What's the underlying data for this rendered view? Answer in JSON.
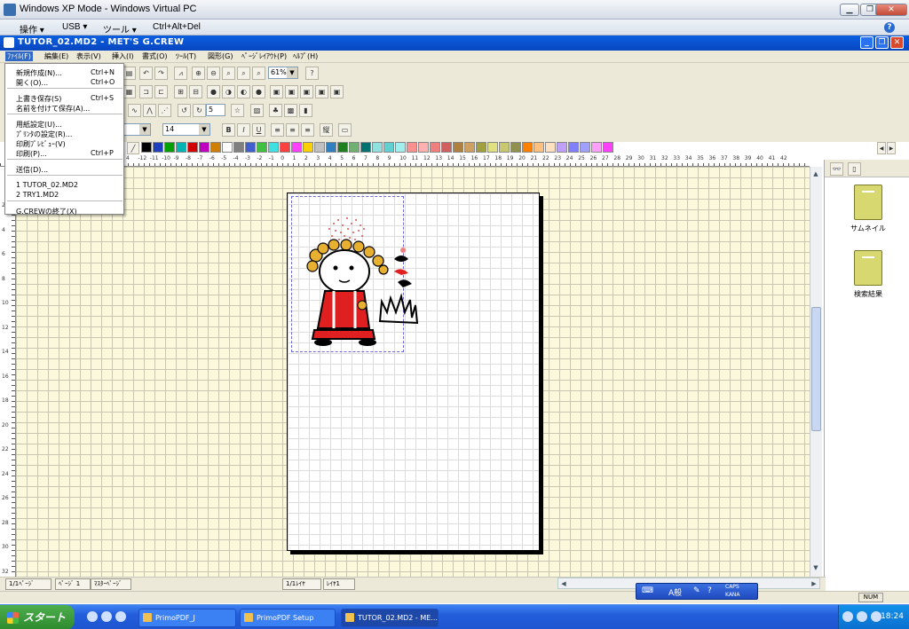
{
  "vpc": {
    "title": "Windows XP Mode - Windows Virtual PC",
    "menu": [
      "操作 ▾",
      "USB ▾",
      "ツール ▾",
      "Ctrl+Alt+Del"
    ],
    "help_icon": "help-icon"
  },
  "app": {
    "title": "TUTOR_02.MD2 - MET'S G.CREW",
    "menu": [
      "ﾌｧｲﾙ(F)",
      "編集(E)",
      "表示(V)",
      "挿入(I)",
      "書式(O)",
      "ﾂｰﾙ(T)",
      "図形(G)",
      "ﾍﾟｰｼﾞﾚｲｱｳﾄ(P)",
      "ﾍﾙﾌﾟ(H)"
    ],
    "zoom": "61%",
    "font_size": "14",
    "number_field": "5"
  },
  "file_menu": [
    {
      "label": "新規作成(N)...",
      "shortcut": "Ctrl+N"
    },
    {
      "label": "開く(O)...",
      "shortcut": "Ctrl+O"
    },
    {
      "label": "上書き保存(S)",
      "shortcut": "Ctrl+S"
    },
    {
      "label": "名前を付けて保存(A)...",
      "shortcut": ""
    },
    {
      "label": "用紙設定(U)...",
      "shortcut": ""
    },
    {
      "label": "ﾌﾟﾘﾝﾀの設定(R)...",
      "shortcut": ""
    },
    {
      "label": "印刷ﾌﾟﾚﾋﾞｭｰ(V)",
      "shortcut": ""
    },
    {
      "label": "印刷(P)...",
      "shortcut": "Ctrl+P"
    },
    {
      "label": "送信(D)...",
      "shortcut": ""
    },
    {
      "label": "1 TUTOR_02.MD2",
      "shortcut": ""
    },
    {
      "label": "2 TRY1.MD2",
      "shortcut": ""
    },
    {
      "label": "G.CREWの終了(X)",
      "shortcut": ""
    }
  ],
  "toolbar_buttons": {
    "bold": "B",
    "italic": "I",
    "underline": "U"
  },
  "palette": [
    "#000000",
    "#1d3fbf",
    "#00a000",
    "#00b4b4",
    "#d00000",
    "#c000c0",
    "#d08000",
    "#ffffff",
    "#808080",
    "#4060d0",
    "#40c040",
    "#40e0e0",
    "#ff4040",
    "#ff40ff",
    "#ffd000",
    "#c0c0c0",
    "#3080c0",
    "#208020",
    "#70b070",
    "#007070",
    "#90e0e0",
    "#60d0d0",
    "#a0f0f0",
    "#ff9090",
    "#ffb0b0",
    "#f08080",
    "#d06060",
    "#b08040",
    "#d0a060",
    "#a0a040",
    "#e0e080",
    "#c8c870",
    "#909050",
    "#ff8000",
    "#ffc080",
    "#ffe0c0",
    "#c0a0ff",
    "#8080ff",
    "#a0a0ff",
    "#ffa0ff",
    "#ff40ff"
  ],
  "ruler": {
    "h_ticks": [
      "4",
      "-12",
      "-11",
      "-10",
      "-9",
      "-8",
      "-7",
      "-6",
      "-5",
      "-4",
      "-3",
      "-2",
      "-1",
      "0",
      "1",
      "2",
      "3",
      "4",
      "5",
      "6",
      "7",
      "8",
      "9",
      "10",
      "11",
      "12",
      "13",
      "14",
      "15",
      "16",
      "17",
      "18",
      "19",
      "20",
      "21",
      "22",
      "23",
      "24",
      "25",
      "26",
      "27",
      "28",
      "29",
      "30",
      "31",
      "32",
      "33",
      "34",
      "35",
      "36",
      "37",
      "38",
      "39",
      "40",
      "41",
      "42"
    ],
    "v_ticks": [
      "2",
      "4",
      "6",
      "8",
      "10",
      "12",
      "14",
      "16",
      "18",
      "20",
      "22",
      "24",
      "26",
      "28",
      "30",
      "32"
    ]
  },
  "right_panel": {
    "items": [
      "サムネイル",
      "検索結果"
    ]
  },
  "bottom": {
    "page_info": "1/1ﾍﾟｰｼﾞ",
    "page_tab": "ﾍﾟｰｼﾞ 1",
    "master_tab": "ﾏｽﾀｰﾍﾟｰｼﾞ",
    "layer_info": "1/1ﾚｲﾔ",
    "layer_tab": "ﾚｲﾔ1",
    "num_indicator": "NUM"
  },
  "ime": {
    "mode": "A般",
    "caps": "CAPS",
    "kana": "KANA"
  },
  "taskbar": {
    "start_label": "スタート",
    "tasks": [
      "PrimoPDF_J",
      "PrimoPDF Setup",
      "TUTOR_02.MD2 - ME..."
    ],
    "clock": "18:24"
  }
}
